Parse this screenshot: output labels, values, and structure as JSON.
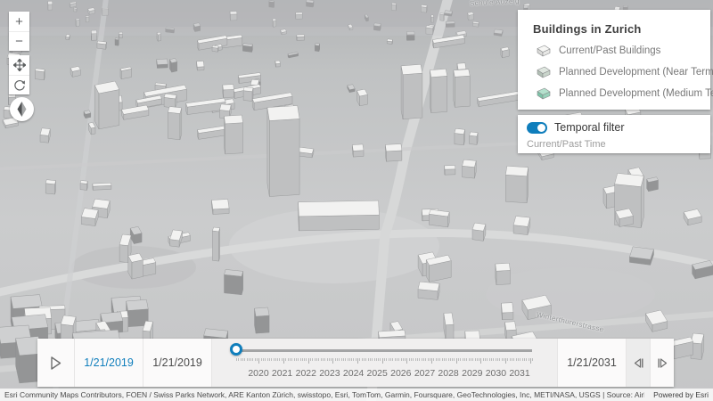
{
  "map": {
    "labels": [
      {
        "text": "Schule Auzelg"
      },
      {
        "text": "Winterthurerstrasse"
      }
    ]
  },
  "nav_controls": {
    "zoom_in": "+",
    "zoom_out": "−"
  },
  "legend": {
    "title": "Buildings in Zurich",
    "items": [
      {
        "label": "Current/Past Buildings",
        "roof": "#f7f7f5",
        "front": "#e8e8e6",
        "side": "#d9d9d7"
      },
      {
        "label": "Planned Development (Near Term)",
        "roof": "#dee6df",
        "front": "#c9d5cb",
        "side": "#b2c0b5"
      },
      {
        "label": "Planned Development (Medium Term)",
        "roof": "#b4e1cd",
        "front": "#98d3bb",
        "side": "#7cc4a8"
      }
    ]
  },
  "temporal_filter": {
    "label": "Temporal filter",
    "state": "on",
    "sublabel": "Current/Past Time",
    "accent": "#0f7ebc"
  },
  "time_slider": {
    "start_date": "1/21/2019",
    "current_date": "1/21/2019",
    "end_date": "1/21/2031",
    "years": [
      "2020",
      "2021",
      "2022",
      "2023",
      "2024",
      "2025",
      "2026",
      "2027",
      "2028",
      "2029",
      "2030",
      "2031"
    ]
  },
  "attribution": {
    "sources": "Esri Community Maps Contributors, FOEN / Swiss Parks Network, ARE Kanton Zürich, swisstopo, Esri, TomTom, Garmin, Foursquare, GeoTechnologies, Inc, METI/NASA, USGS | Source: Airbus,...",
    "powered_by": "Powered by Esri"
  }
}
